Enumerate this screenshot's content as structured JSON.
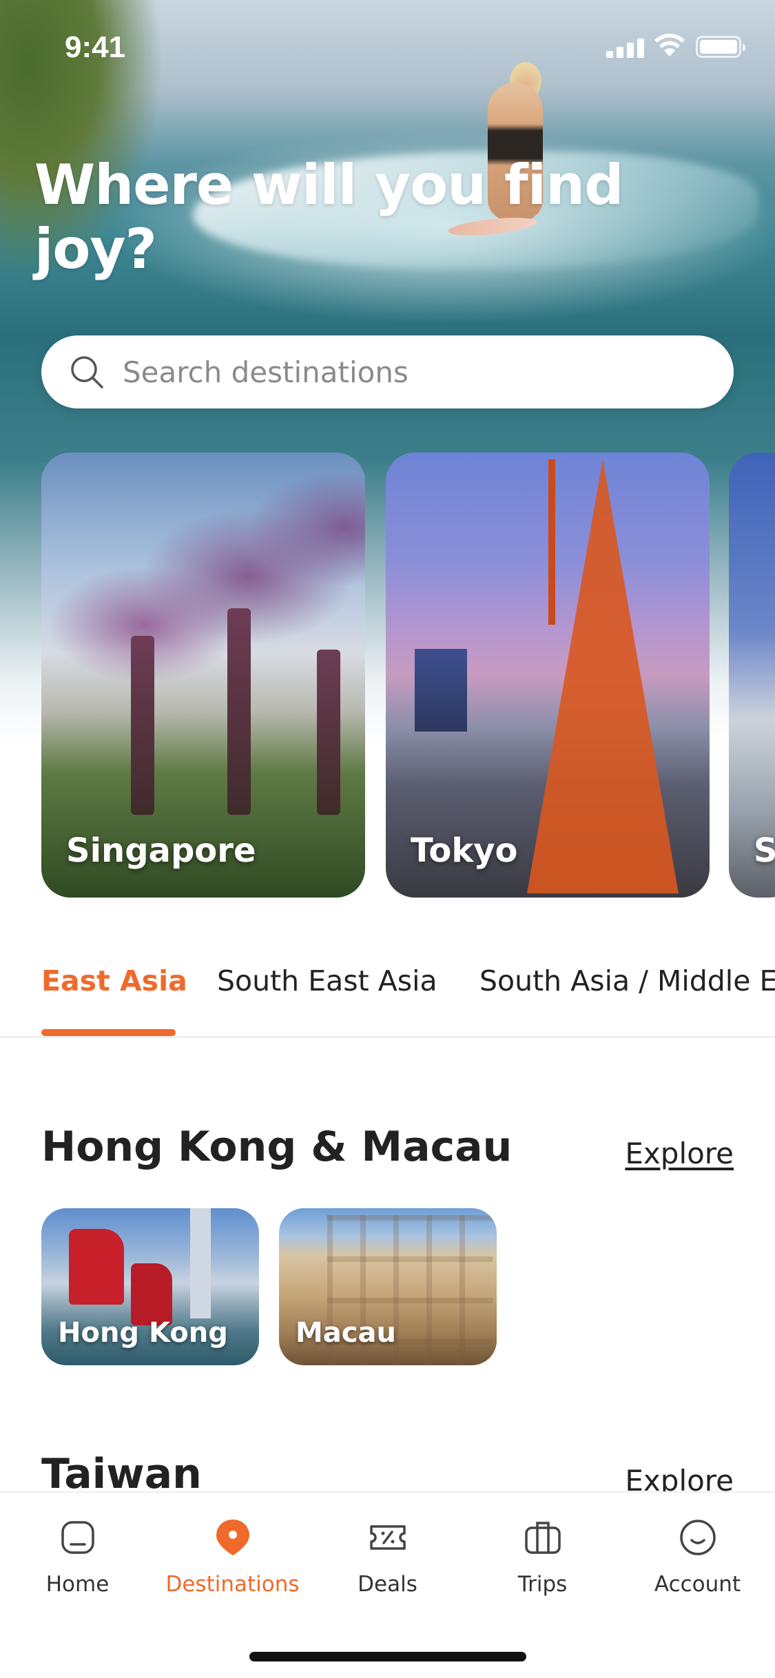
{
  "status_bar": {
    "time": "9:41"
  },
  "hero": {
    "headline": "Where will you find joy?",
    "search": {
      "placeholder": "Search destinations",
      "value": ""
    }
  },
  "featured": [
    {
      "name": "Singapore"
    },
    {
      "name": "Tokyo"
    },
    {
      "name": "S"
    }
  ],
  "tabs": [
    {
      "label": "East Asia",
      "active": true
    },
    {
      "label": "South East Asia",
      "active": false
    },
    {
      "label": "South Asia / Middle E",
      "active": false
    }
  ],
  "sections": [
    {
      "title": "Hong Kong & Macau",
      "explore_label": "Explore",
      "cities": [
        {
          "name": "Hong Kong"
        },
        {
          "name": "Macau"
        }
      ]
    },
    {
      "title": "Taiwan",
      "explore_label": "Explore"
    }
  ],
  "bottom_nav": [
    {
      "label": "Home",
      "icon": "home-icon",
      "active": false
    },
    {
      "label": "Destinations",
      "icon": "location-pin-icon",
      "active": true
    },
    {
      "label": "Deals",
      "icon": "ticket-icon",
      "active": false
    },
    {
      "label": "Trips",
      "icon": "suitcase-icon",
      "active": false
    },
    {
      "label": "Account",
      "icon": "account-icon",
      "active": false
    }
  ],
  "colors": {
    "accent": "#ef6a2b",
    "text": "#222222",
    "muted": "#8a8a8a"
  }
}
